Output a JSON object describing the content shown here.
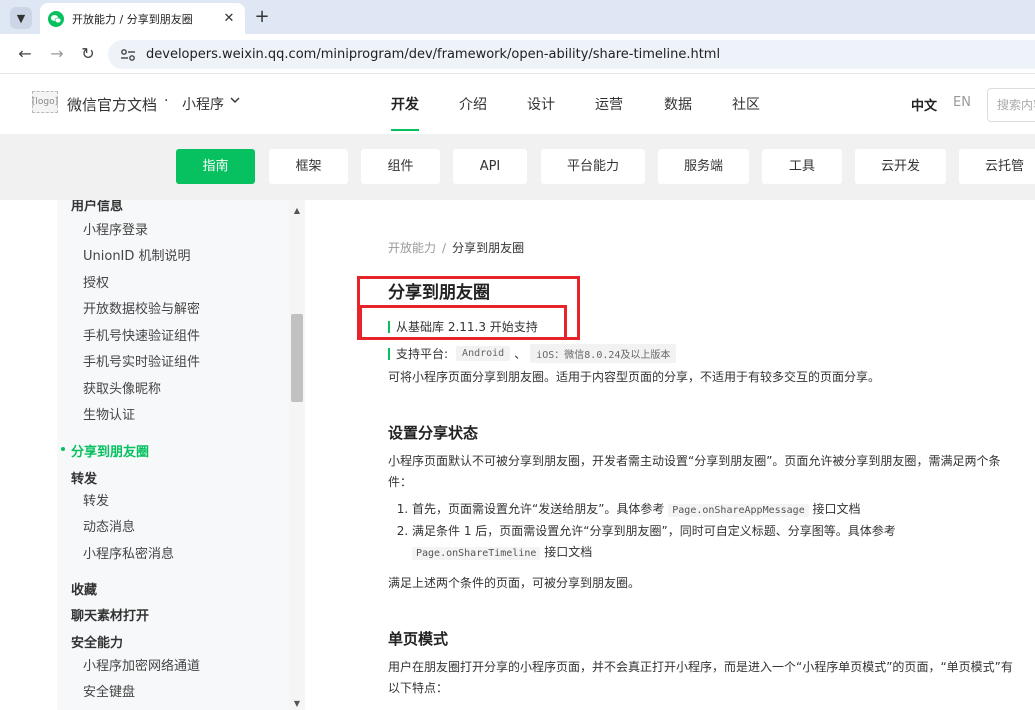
{
  "browser": {
    "tab_title": "开放能力 / 分享到朋友圈",
    "new_tab": "+",
    "url": "developers.weixin.qq.com/miniprogram/dev/framework/open-ability/share-timeline.html"
  },
  "header": {
    "brand": "微信官方文档",
    "separator": "·",
    "product": "小程序",
    "nav": [
      "开发",
      "介绍",
      "设计",
      "运营",
      "数据",
      "社区"
    ],
    "lang_zh": "中文",
    "lang_en": "EN",
    "search_placeholder": "搜索内容"
  },
  "subnav": [
    "指南",
    "框架",
    "组件",
    "API",
    "平台能力",
    "服务端",
    "工具",
    "云开发",
    "云托管"
  ],
  "sidebar": {
    "items": [
      {
        "label": "用户信息",
        "kind": "group"
      },
      {
        "label": "小程序登录",
        "kind": "sub"
      },
      {
        "label": "UnionID 机制说明",
        "kind": "sub"
      },
      {
        "label": "授权",
        "kind": "sub"
      },
      {
        "label": "开放数据校验与解密",
        "kind": "sub"
      },
      {
        "label": "手机号快速验证组件",
        "kind": "sub"
      },
      {
        "label": "手机号实时验证组件",
        "kind": "sub"
      },
      {
        "label": "获取头像昵称",
        "kind": "sub"
      },
      {
        "label": "生物认证",
        "kind": "sub"
      },
      {
        "label": "分享到朋友圈",
        "kind": "active"
      },
      {
        "label": "转发",
        "kind": "group"
      },
      {
        "label": "转发",
        "kind": "sub"
      },
      {
        "label": "动态消息",
        "kind": "sub"
      },
      {
        "label": "小程序私密消息",
        "kind": "sub"
      },
      {
        "label": "收藏",
        "kind": "group"
      },
      {
        "label": "聊天素材打开",
        "kind": "group"
      },
      {
        "label": "安全能力",
        "kind": "group"
      },
      {
        "label": "小程序加密网络通道",
        "kind": "sub"
      },
      {
        "label": "安全键盘",
        "kind": "sub"
      }
    ]
  },
  "content": {
    "breadcrumb_parent": "开放能力",
    "breadcrumb_sep": "/",
    "breadcrumb_current": "分享到朋友圈",
    "title": "分享到朋友圈",
    "since_label": "从基础库 2.11.3 开始支持",
    "platform_label": "支持平台:",
    "platform_android": "Android",
    "platform_sep": "、",
    "platform_ios": "iOS：微信8.0.24及以上版本",
    "intro": "可将小程序页面分享到朋友圈。适用于内容型页面的分享，不适用于有较多交互的页面分享。",
    "section1_title": "设置分享状态",
    "section1_p": "小程序页面默认不可被分享到朋友圈，开发者需主动设置“分享到朋友圈”。页面允许被分享到朋友圈，需满足两个条件：",
    "step1_text": "首先，页面需设置允许“发送给朋友”。具体参考",
    "step1_code": "Page.onShareAppMessage",
    "step1_suffix": "接口文档",
    "step2_text": "满足条件 1 后，页面需设置允许“分享到朋友圈”，同时可自定义标题、分享图等。具体参考",
    "step2_code": "Page.onShareTimeline",
    "step2_suffix": "接口文档",
    "section1_note": "满足上述两个条件的页面，可被分享到朋友圈。",
    "section2_title": "单页模式",
    "section2_p": "用户在朋友圈打开分享的小程序页面，并不会真正打开小程序，而是进入一个“小程序单页模式”的页面，“单页模式”有以下特点："
  },
  "colors": {
    "accent": "#07c160",
    "highlight": "#e8242b"
  }
}
